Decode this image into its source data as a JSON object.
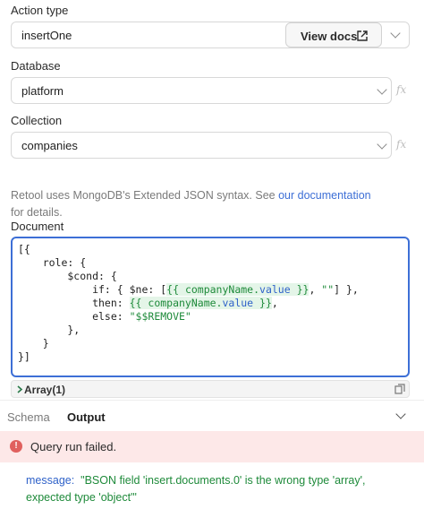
{
  "action_type": {
    "label": "Action type",
    "value": "insertOne",
    "view_docs_label": "View docs"
  },
  "database": {
    "label": "Database",
    "value": "platform"
  },
  "collection": {
    "label": "Collection",
    "value": "companies"
  },
  "info": {
    "text_before": "Retool uses MongoDB's Extended JSON syntax. See ",
    "link_text": "our documentation",
    "text_after": " for details."
  },
  "document": {
    "label": "Document",
    "lines": [
      "[{",
      "    role: {",
      "        $cond: {",
      "            if: { $ne: [{{ companyName.value }}, \"\"] },",
      "            then: {{ companyName.value }},",
      "            else: \"$$REMOVE\"",
      "        },",
      "    }",
      "}]"
    ]
  },
  "result_preview": {
    "label": "Array(1)"
  },
  "tabs": {
    "schema": "Schema",
    "output": "Output",
    "active": "Output"
  },
  "error": {
    "title": "Query run failed."
  },
  "message": {
    "key": "message:",
    "value": "\"BSON field 'insert.documents.0' is the wrong type 'array', expected type 'object'\""
  },
  "colors": {
    "accent": "#3d6fd6",
    "error_bg": "#fde8e8",
    "error_icon": "#e0605e",
    "string": "#1e8a3a"
  },
  "icons": [
    "external-link-icon",
    "chevron-down-icon",
    "fx-icon",
    "chevron-right-icon",
    "copy-icon",
    "error-icon"
  ]
}
